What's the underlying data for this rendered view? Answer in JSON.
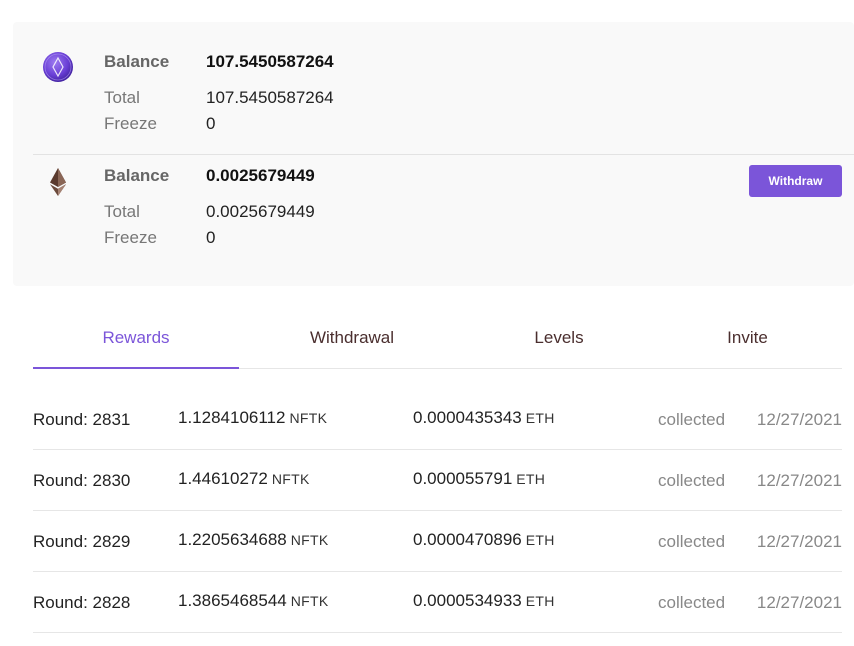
{
  "assets": [
    {
      "icon": "nftk-coin-icon",
      "balance_label": "Balance",
      "balance": "107.5450587264",
      "total_label": "Total",
      "total": "107.5450587264",
      "freeze_label": "Freeze",
      "freeze": "0"
    },
    {
      "icon": "ethereum-icon",
      "balance_label": "Balance",
      "balance": "0.0025679449",
      "total_label": "Total",
      "total": "0.0025679449",
      "freeze_label": "Freeze",
      "freeze": "0",
      "withdraw_label": "Withdraw"
    }
  ],
  "tabs": [
    {
      "label": "Rewards",
      "active": true
    },
    {
      "label": "Withdrawal",
      "active": false
    },
    {
      "label": "Levels",
      "active": false
    },
    {
      "label": "Invite",
      "active": false
    }
  ],
  "rewards": [
    {
      "round": "Round: 2831",
      "nftk": "1.1284106112",
      "nftk_unit": "NFTK",
      "eth": "0.0000435343",
      "eth_unit": "ETH",
      "status": "collected",
      "date": "12/27/2021"
    },
    {
      "round": "Round: 2830",
      "nftk": "1.44610272",
      "nftk_unit": "NFTK",
      "eth": "0.000055791",
      "eth_unit": "ETH",
      "status": "collected",
      "date": "12/27/2021"
    },
    {
      "round": "Round: 2829",
      "nftk": "1.2205634688",
      "nftk_unit": "NFTK",
      "eth": "0.0000470896",
      "eth_unit": "ETH",
      "status": "collected",
      "date": "12/27/2021"
    },
    {
      "round": "Round: 2828",
      "nftk": "1.3865468544",
      "nftk_unit": "NFTK",
      "eth": "0.0000534933",
      "eth_unit": "ETH",
      "status": "collected",
      "date": "12/27/2021"
    }
  ],
  "colors": {
    "accent": "#7b55d9",
    "tab_text": "#4a2e2e",
    "muted": "#888888"
  }
}
